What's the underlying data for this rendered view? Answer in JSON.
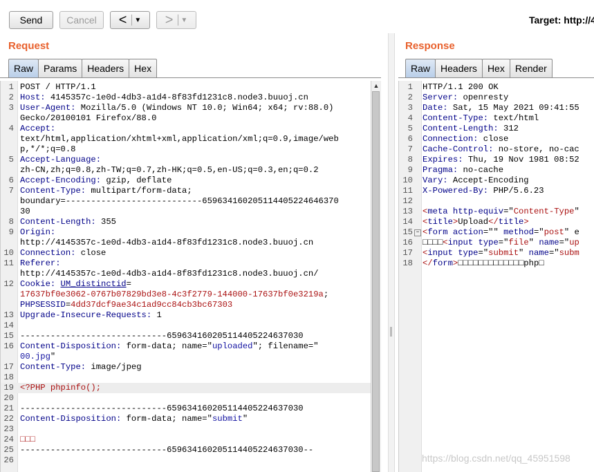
{
  "toolbar": {
    "send_label": "Send",
    "cancel_label": "Cancel",
    "back_arrow": "<",
    "forward_arrow": ">",
    "dropdown_glyph": "▼",
    "target_label": "Target: http://4"
  },
  "request": {
    "title": "Request",
    "tabs": [
      "Raw",
      "Params",
      "Headers",
      "Hex"
    ],
    "active_tab": "Raw"
  },
  "response": {
    "title": "Response",
    "tabs": [
      "Raw",
      "Headers",
      "Hex",
      "Render"
    ],
    "active_tab": "Raw"
  },
  "watermark": "https://blog.csdn.net/qq_45951598",
  "request_lines": [
    {
      "n": "1",
      "parts": [
        [
          "q",
          "POST / HTTP/1.1"
        ]
      ]
    },
    {
      "n": "2",
      "parts": [
        [
          "k",
          "Host:"
        ],
        [
          "q",
          " 4145357c-1e0d-4db3-a1d4-8f83fd1231c8.node3.buuoj.cn"
        ]
      ]
    },
    {
      "n": "3",
      "parts": [
        [
          "k",
          "User-Agent:"
        ],
        [
          "q",
          " Mozilla/5.0 (Windows NT 10.0; Win64; x64; rv:88.0)"
        ]
      ]
    },
    {
      "n": "",
      "parts": [
        [
          "q",
          "Gecko/20100101 Firefox/88.0"
        ]
      ]
    },
    {
      "n": "4",
      "parts": [
        [
          "k",
          "Accept:"
        ]
      ]
    },
    {
      "n": "",
      "parts": [
        [
          "q",
          "text/html,application/xhtml+xml,application/xml;q=0.9,image/web"
        ]
      ]
    },
    {
      "n": "",
      "parts": [
        [
          "q",
          "p,*/*;q=0.8"
        ]
      ]
    },
    {
      "n": "5",
      "parts": [
        [
          "k",
          "Accept-Language:"
        ]
      ]
    },
    {
      "n": "",
      "parts": [
        [
          "q",
          "zh-CN,zh;q=0.8,zh-TW;q=0.7,zh-HK;q=0.5,en-US;q=0.3,en;q=0.2"
        ]
      ]
    },
    {
      "n": "6",
      "parts": [
        [
          "k",
          "Accept-Encoding:"
        ],
        [
          "q",
          " gzip, deflate"
        ]
      ]
    },
    {
      "n": "7",
      "parts": [
        [
          "k",
          "Content-Type:"
        ],
        [
          "q",
          " multipart/form-data;"
        ]
      ]
    },
    {
      "n": "",
      "parts": [
        [
          "q",
          "boundary=---------------------------659634160205114405224646370"
        ]
      ]
    },
    {
      "n": "",
      "parts": [
        [
          "q",
          "30"
        ]
      ]
    },
    {
      "n": "8",
      "parts": [
        [
          "k",
          "Content-Length:"
        ],
        [
          "q",
          " 355"
        ]
      ]
    },
    {
      "n": "9",
      "parts": [
        [
          "k",
          "Origin:"
        ]
      ]
    },
    {
      "n": "",
      "parts": [
        [
          "q",
          "http://4145357c-1e0d-4db3-a1d4-8f83fd1231c8.node3.buuoj.cn"
        ]
      ]
    },
    {
      "n": "10",
      "parts": [
        [
          "k",
          "Connection:"
        ],
        [
          "q",
          " close"
        ]
      ]
    },
    {
      "n": "11",
      "parts": [
        [
          "k",
          "Referer:"
        ]
      ]
    },
    {
      "n": "",
      "parts": [
        [
          "q",
          "http://4145357c-1e0d-4db3-a1d4-8f83fd1231c8.node3.buuoj.cn/"
        ]
      ]
    },
    {
      "n": "12",
      "parts": [
        [
          "k",
          "Cookie:"
        ],
        [
          "q",
          " "
        ],
        [
          "u",
          "UM_distinctid"
        ],
        [
          "q",
          "="
        ]
      ]
    },
    {
      "n": "",
      "parts": [
        [
          "r",
          "17637bf0e3062-0767b07829bd3e8-4c3f2779-144000-17637bf0e3219a"
        ],
        [
          "q",
          ";"
        ]
      ]
    },
    {
      "n": "",
      "parts": [
        [
          "k",
          "PHPSESSID"
        ],
        [
          "q",
          "="
        ],
        [
          "r",
          "4dd37dcf9ae34c1ad9cc84cb3bc67303"
        ]
      ]
    },
    {
      "n": "13",
      "parts": [
        [
          "k",
          "Upgrade-Insecure-Requests:"
        ],
        [
          "q",
          " 1"
        ]
      ]
    },
    {
      "n": "14",
      "parts": []
    },
    {
      "n": "15",
      "parts": [
        [
          "q",
          "-----------------------------659634160205114405224637030"
        ]
      ]
    },
    {
      "n": "16",
      "parts": [
        [
          "k",
          "Content-Disposition:"
        ],
        [
          "q",
          " form-data; name=\""
        ],
        [
          "s",
          "uploaded"
        ],
        [
          "q",
          "\"; filename=\""
        ]
      ]
    },
    {
      "n": "",
      "parts": [
        [
          "s",
          "00.jpg"
        ],
        [
          "q",
          "\""
        ]
      ]
    },
    {
      "n": "17",
      "parts": [
        [
          "k",
          "Content-Type:"
        ],
        [
          "q",
          " image/jpeg"
        ]
      ]
    },
    {
      "n": "18",
      "parts": []
    },
    {
      "n": "19",
      "hl": true,
      "parts": [
        [
          "r",
          "<?PHP phpinfo();"
        ]
      ]
    },
    {
      "n": "20",
      "parts": []
    },
    {
      "n": "21",
      "parts": [
        [
          "q",
          "-----------------------------659634160205114405224637030"
        ]
      ]
    },
    {
      "n": "22",
      "parts": [
        [
          "k",
          "Content-Disposition:"
        ],
        [
          "q",
          " form-data; name=\""
        ],
        [
          "s",
          "submit"
        ],
        [
          "q",
          "\""
        ]
      ]
    },
    {
      "n": "23",
      "parts": []
    },
    {
      "n": "24",
      "parts": [
        [
          "r",
          "□□□"
        ]
      ]
    },
    {
      "n": "25",
      "parts": [
        [
          "q",
          "-----------------------------659634160205114405224637030--"
        ]
      ]
    },
    {
      "n": "26",
      "parts": []
    }
  ],
  "response_lines": [
    {
      "n": "1",
      "parts": [
        [
          "q",
          "HTTP/1.1 200 OK"
        ]
      ]
    },
    {
      "n": "2",
      "parts": [
        [
          "k",
          "Server:"
        ],
        [
          "q",
          " openresty"
        ]
      ]
    },
    {
      "n": "3",
      "parts": [
        [
          "k",
          "Date:"
        ],
        [
          "q",
          " Sat, 15 May 2021 09:41:55"
        ]
      ]
    },
    {
      "n": "4",
      "parts": [
        [
          "k",
          "Content-Type:"
        ],
        [
          "q",
          " text/html"
        ]
      ]
    },
    {
      "n": "5",
      "parts": [
        [
          "k",
          "Content-Length:"
        ],
        [
          "q",
          " 312"
        ]
      ]
    },
    {
      "n": "6",
      "parts": [
        [
          "k",
          "Connection:"
        ],
        [
          "q",
          " close"
        ]
      ]
    },
    {
      "n": "7",
      "parts": [
        [
          "k",
          "Cache-Control:"
        ],
        [
          "q",
          " no-store, no-cac"
        ]
      ]
    },
    {
      "n": "8",
      "parts": [
        [
          "k",
          "Expires:"
        ],
        [
          "q",
          " Thu, 19 Nov 1981 08:52"
        ]
      ]
    },
    {
      "n": "9",
      "parts": [
        [
          "k",
          "Pragma:"
        ],
        [
          "q",
          " no-cache"
        ]
      ]
    },
    {
      "n": "10",
      "parts": [
        [
          "k",
          "Vary:"
        ],
        [
          "q",
          " Accept-Encoding"
        ]
      ]
    },
    {
      "n": "11",
      "parts": [
        [
          "k",
          "X-Powered-By:"
        ],
        [
          "q",
          " PHP/5.6.23"
        ]
      ]
    },
    {
      "n": "12",
      "parts": []
    },
    {
      "n": "13",
      "parts": [
        [
          "r",
          "<"
        ],
        [
          "k",
          "meta"
        ],
        [
          "q",
          " "
        ],
        [
          "k",
          "http-equiv"
        ],
        [
          "q",
          "=\""
        ],
        [
          "r",
          "Content-Type"
        ],
        [
          "q",
          "\""
        ]
      ]
    },
    {
      "n": "14",
      "parts": [
        [
          "r",
          "<"
        ],
        [
          "k",
          "title"
        ],
        [
          "r",
          ">"
        ],
        [
          "q",
          "Upload"
        ],
        [
          "r",
          "</"
        ],
        [
          "k",
          "title"
        ],
        [
          "r",
          ">"
        ]
      ]
    },
    {
      "n": "15",
      "fold": true,
      "parts": [
        [
          "r",
          "<"
        ],
        [
          "k",
          "form"
        ],
        [
          "q",
          " "
        ],
        [
          "k",
          "action"
        ],
        [
          "q",
          "=\"\" "
        ],
        [
          "k",
          "method"
        ],
        [
          "q",
          "=\""
        ],
        [
          "r",
          "post"
        ],
        [
          "q",
          "\" e"
        ]
      ]
    },
    {
      "n": "16",
      "parts": [
        [
          "q",
          "□□□□"
        ],
        [
          "r",
          "<"
        ],
        [
          "k",
          "input"
        ],
        [
          "q",
          " "
        ],
        [
          "k",
          "type"
        ],
        [
          "q",
          "=\""
        ],
        [
          "r",
          "file"
        ],
        [
          "q",
          "\" "
        ],
        [
          "k",
          "name"
        ],
        [
          "q",
          "=\""
        ],
        [
          "r",
          "up"
        ]
      ]
    },
    {
      "n": "17",
      "parts": [
        [
          "r",
          "<"
        ],
        [
          "k",
          "input"
        ],
        [
          "q",
          " "
        ],
        [
          "k",
          "type"
        ],
        [
          "q",
          "=\""
        ],
        [
          "r",
          "submit"
        ],
        [
          "q",
          "\" "
        ],
        [
          "k",
          "name"
        ],
        [
          "q",
          "=\""
        ],
        [
          "r",
          "subm"
        ]
      ]
    },
    {
      "n": "18",
      "parts": [
        [
          "r",
          "</"
        ],
        [
          "k",
          "form"
        ],
        [
          "r",
          ">"
        ],
        [
          "q",
          "□□□□□□□□□□□□□php□"
        ]
      ]
    }
  ]
}
